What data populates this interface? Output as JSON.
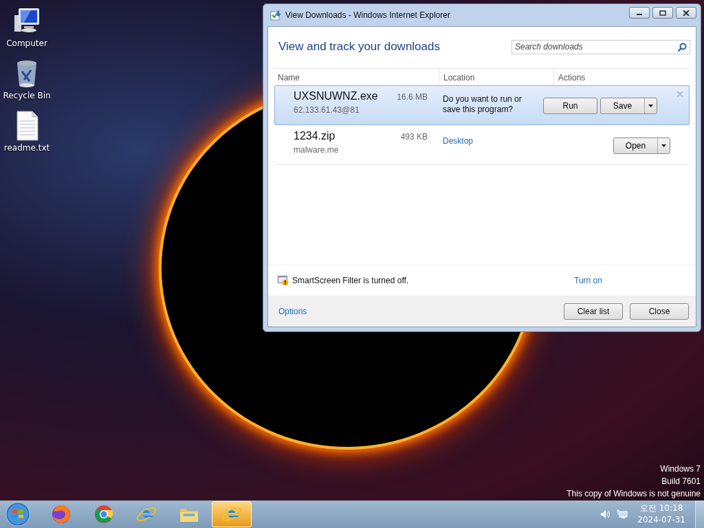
{
  "desktop": {
    "icons": [
      {
        "kind": "computer",
        "label": "Computer"
      },
      {
        "kind": "recycle",
        "label": "Recycle Bin"
      },
      {
        "kind": "text",
        "label": "readme.txt"
      }
    ],
    "notice": [
      "Windows 7",
      "Build 7601",
      "This copy of Windows is not genuine"
    ]
  },
  "window": {
    "title": "View Downloads - Windows Internet Explorer",
    "heading": "View and track your downloads",
    "search": {
      "placeholder": "Search downloads"
    },
    "columns": [
      "Name",
      "Location",
      "Actions"
    ],
    "downloads": [
      {
        "name": "UXSNUWNZ.exe",
        "size": "16.6 MB",
        "source": "62.133.61.43@81",
        "kind": "prompt",
        "message": "Do you want to run or save this program?",
        "selected": true,
        "actions": [
          {
            "label": "Run",
            "split": false
          },
          {
            "label": "Save",
            "split": true
          }
        ]
      },
      {
        "name": "1234.zip",
        "size": "493 KB",
        "source": "malware.me",
        "kind": "done",
        "location": "Desktop",
        "selected": false,
        "actions": [
          {
            "label": "Open",
            "split": true
          }
        ]
      }
    ],
    "smartscreen": {
      "message": "SmartScreen Filter is turned off.",
      "link": "Turn on"
    },
    "footer": {
      "link": "Options",
      "buttons": [
        "Clear list",
        "Close"
      ]
    }
  },
  "taskbar": {
    "apps": [
      {
        "kind": "firefox",
        "active": false
      },
      {
        "kind": "chrome",
        "active": false
      },
      {
        "kind": "ie",
        "active": false
      },
      {
        "kind": "explorer",
        "active": false
      },
      {
        "kind": "ie",
        "active": true
      }
    ],
    "time": "오전 10:18",
    "date": "2024-07-31"
  }
}
